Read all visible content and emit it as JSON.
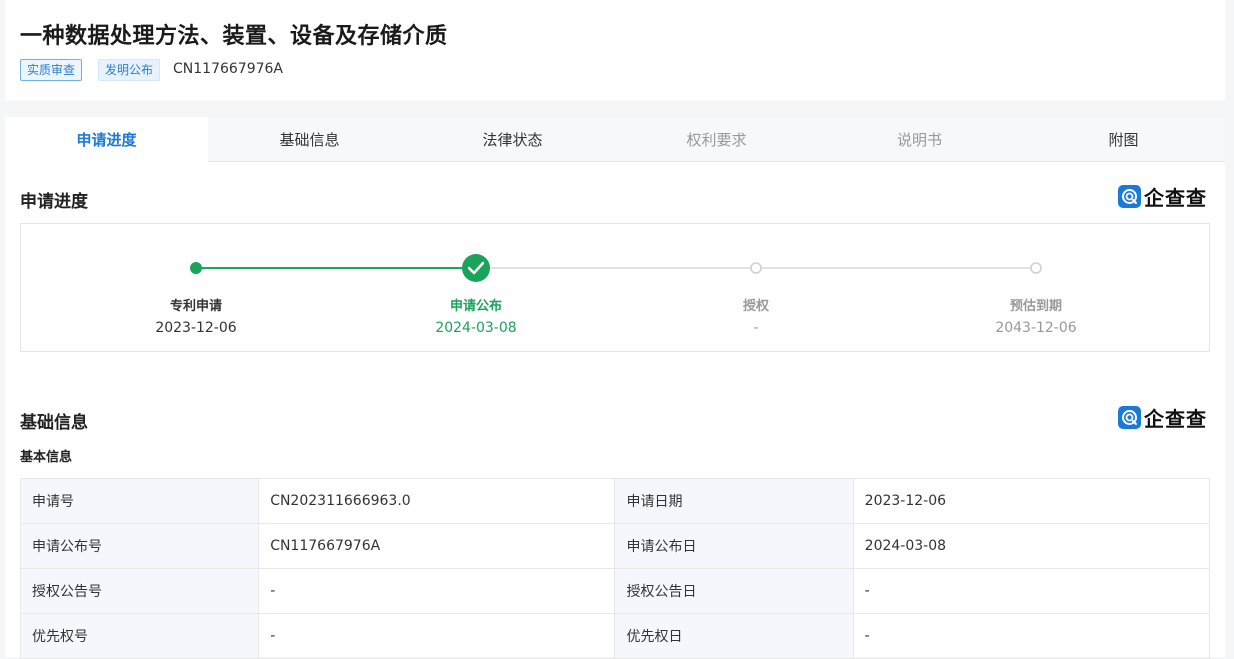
{
  "header": {
    "title": "一种数据处理方法、装置、设备及存储介质",
    "tags": [
      "实质审查",
      "发明公布"
    ],
    "publication_no": "CN117667976A"
  },
  "tabs": [
    {
      "label": "申请进度"
    },
    {
      "label": "基础信息"
    },
    {
      "label": "法律状态"
    },
    {
      "label": "权利要求"
    },
    {
      "label": "说明书"
    },
    {
      "label": "附图"
    }
  ],
  "progress": {
    "title": "申请进度",
    "logo_text": "企查查",
    "steps": [
      {
        "label": "专利申请",
        "date": "2023-12-06"
      },
      {
        "label": "申请公布",
        "date": "2024-03-08"
      },
      {
        "label": "授权",
        "date": "-"
      },
      {
        "label": "预估到期",
        "date": "2043-12-06"
      }
    ],
    "colors": {
      "done": "#1aa35a",
      "pending": "#cccccc"
    }
  },
  "basic": {
    "title": "基础信息",
    "logo_text": "企查查",
    "subtitle": "基本信息",
    "rows": [
      {
        "k1": "申请号",
        "v1": "CN202311666963.0",
        "k2": "申请日期",
        "v2": "2023-12-06"
      },
      {
        "k1": "申请公布号",
        "v1": "CN117667976A",
        "k2": "申请公布日",
        "v2": "2024-03-08"
      },
      {
        "k1": "授权公告号",
        "v1": "-",
        "k2": "授权公告日",
        "v2": "-"
      },
      {
        "k1": "优先权号",
        "v1": "-",
        "k2": "优先权日",
        "v2": "-"
      }
    ]
  }
}
